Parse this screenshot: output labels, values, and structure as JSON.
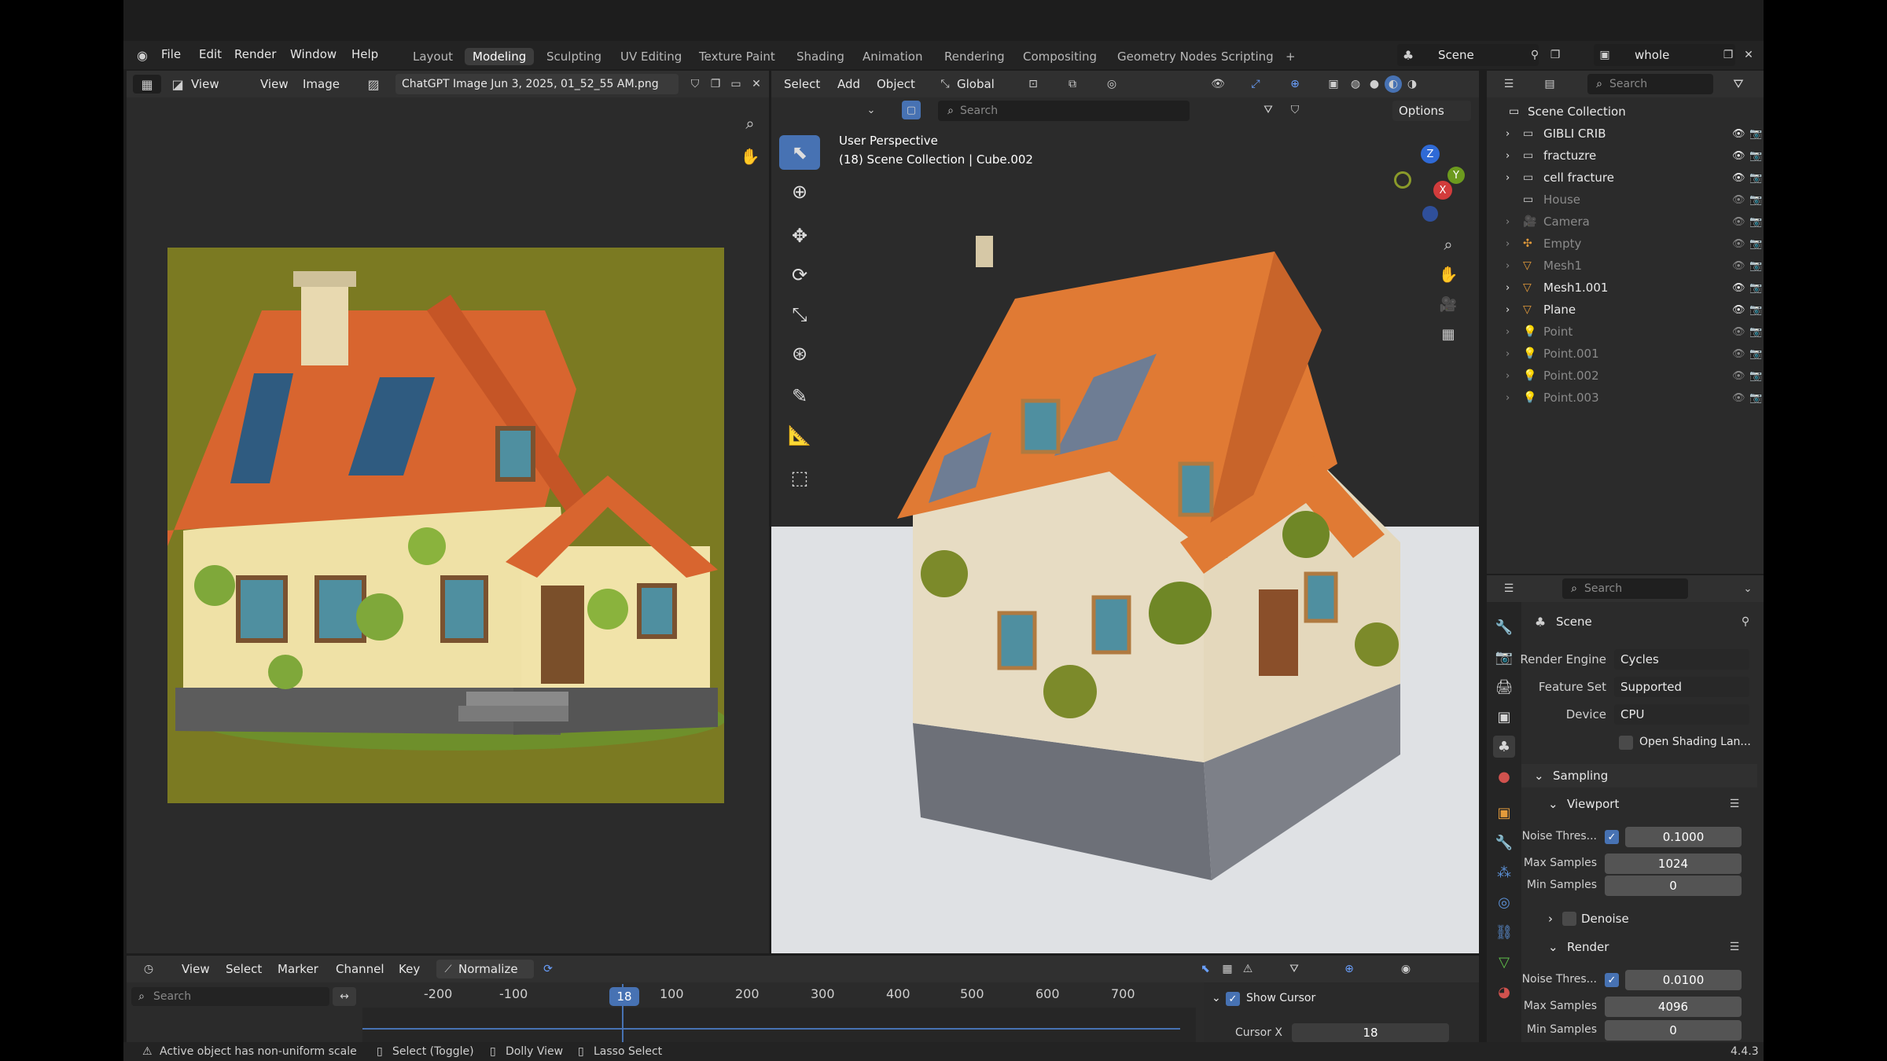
{
  "top_menu": [
    "File",
    "Edit",
    "Render",
    "Window",
    "Help"
  ],
  "workspaces": [
    "Layout",
    "Modeling",
    "Sculpting",
    "UV Editing",
    "Texture Paint",
    "Shading",
    "Animation",
    "Rendering",
    "Compositing",
    "Geometry Nodes",
    "Scripting",
    "+"
  ],
  "active_workspace": "Modeling",
  "scene_name": "Scene",
  "view_layer": "whole",
  "image_editor": {
    "menu": [
      "View",
      "View",
      "Image"
    ],
    "image_name": "ChatGPT Image Jun 3, 2025, 01_52_55 AM.png"
  },
  "viewport": {
    "menu": [
      "Select",
      "Add",
      "Object"
    ],
    "orientation": "Global",
    "search_placeholder": "Search",
    "options": "Options",
    "info_line1": "User Perspective",
    "info_line2": "(18) Scene Collection | Cube.002",
    "gizmo_axes": [
      "Z",
      "X",
      "Y"
    ]
  },
  "outliner": {
    "search_placeholder": "Search",
    "root": "Scene Collection",
    "items": [
      {
        "name": "GIBLI CRIB",
        "dim": false
      },
      {
        "name": "fractuzre",
        "dim": false
      },
      {
        "name": "cell fracture",
        "dim": false
      },
      {
        "name": "House",
        "dim": true
      },
      {
        "name": "Camera",
        "dim": true
      },
      {
        "name": "Empty",
        "dim": true
      },
      {
        "name": "Mesh1",
        "dim": true
      },
      {
        "name": "Mesh1.001",
        "dim": false
      },
      {
        "name": "Plane",
        "dim": false
      },
      {
        "name": "Point",
        "dim": true
      },
      {
        "name": "Point.001",
        "dim": true
      },
      {
        "name": "Point.002",
        "dim": true
      },
      {
        "name": "Point.003",
        "dim": true
      }
    ]
  },
  "properties": {
    "search_placeholder": "Search",
    "context": "Scene",
    "render_engine_label": "Render Engine",
    "render_engine": "Cycles",
    "feature_set_label": "Feature Set",
    "feature_set": "Supported",
    "device_label": "Device",
    "device": "CPU",
    "osl_label": "Open Shading Lan...",
    "sampling": "Sampling",
    "viewport_sec": "Viewport",
    "noise_label": "Noise Thres...",
    "vp_noise": "0.1000",
    "max_samples_label": "Max Samples",
    "vp_max": "1024",
    "min_samples_label": "Min Samples",
    "vp_min": "0",
    "denoise": "Denoise",
    "render_sec": "Render",
    "r_noise": "0.0100",
    "r_max": "4096",
    "r_min": "0"
  },
  "timeline": {
    "menu": [
      "View",
      "Select",
      "Marker",
      "Channel",
      "Key"
    ],
    "normalize": "Normalize",
    "search_placeholder": "Search",
    "current_frame": "18",
    "ticks": [
      "-200",
      "-100",
      "100",
      "200",
      "300",
      "400",
      "500",
      "600",
      "700"
    ],
    "show_cursor": "Show Cursor",
    "cursor_x_label": "Cursor X",
    "cursor_x": "18"
  },
  "status": {
    "warning": "Active object has non-uniform scale",
    "select": "Select (Toggle)",
    "dolly": "Dolly View",
    "lasso": "Lasso Select",
    "version": "4.4.3"
  },
  "colors": {
    "accent": "#4772b3",
    "olive": "#7b7a22",
    "roof": "#d8652f"
  }
}
